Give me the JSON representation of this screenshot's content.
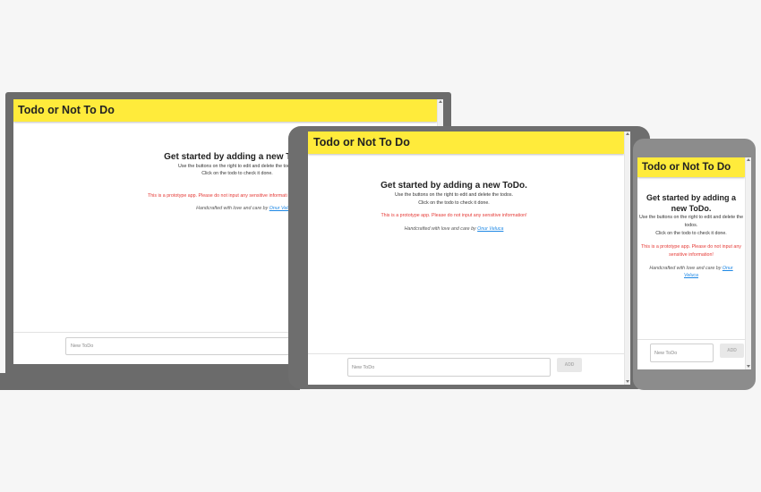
{
  "app": {
    "title": "Todo or Not To Do",
    "heading": "Get started by adding a new ToDo.",
    "help_line1": "Use the buttons on the right to edit and delete the todos.",
    "help_line2": "Click on the todo to check it done.",
    "warning": "This is a prototype app. Please do not input any sensitive information!",
    "credit_prefix": "Handcrafted with love and care by",
    "credit_author": "Onur Veluca",
    "input_placeholder": "New ToDo",
    "add_label": "ADD"
  },
  "laptop": {
    "warning_visible": "This is a prototype app. Please do not input any sensitive informati"
  },
  "colors": {
    "header": "#ffeb3b",
    "warning": "#e53935",
    "link": "#1e88e5",
    "device_frame": "#6b6b6b"
  }
}
